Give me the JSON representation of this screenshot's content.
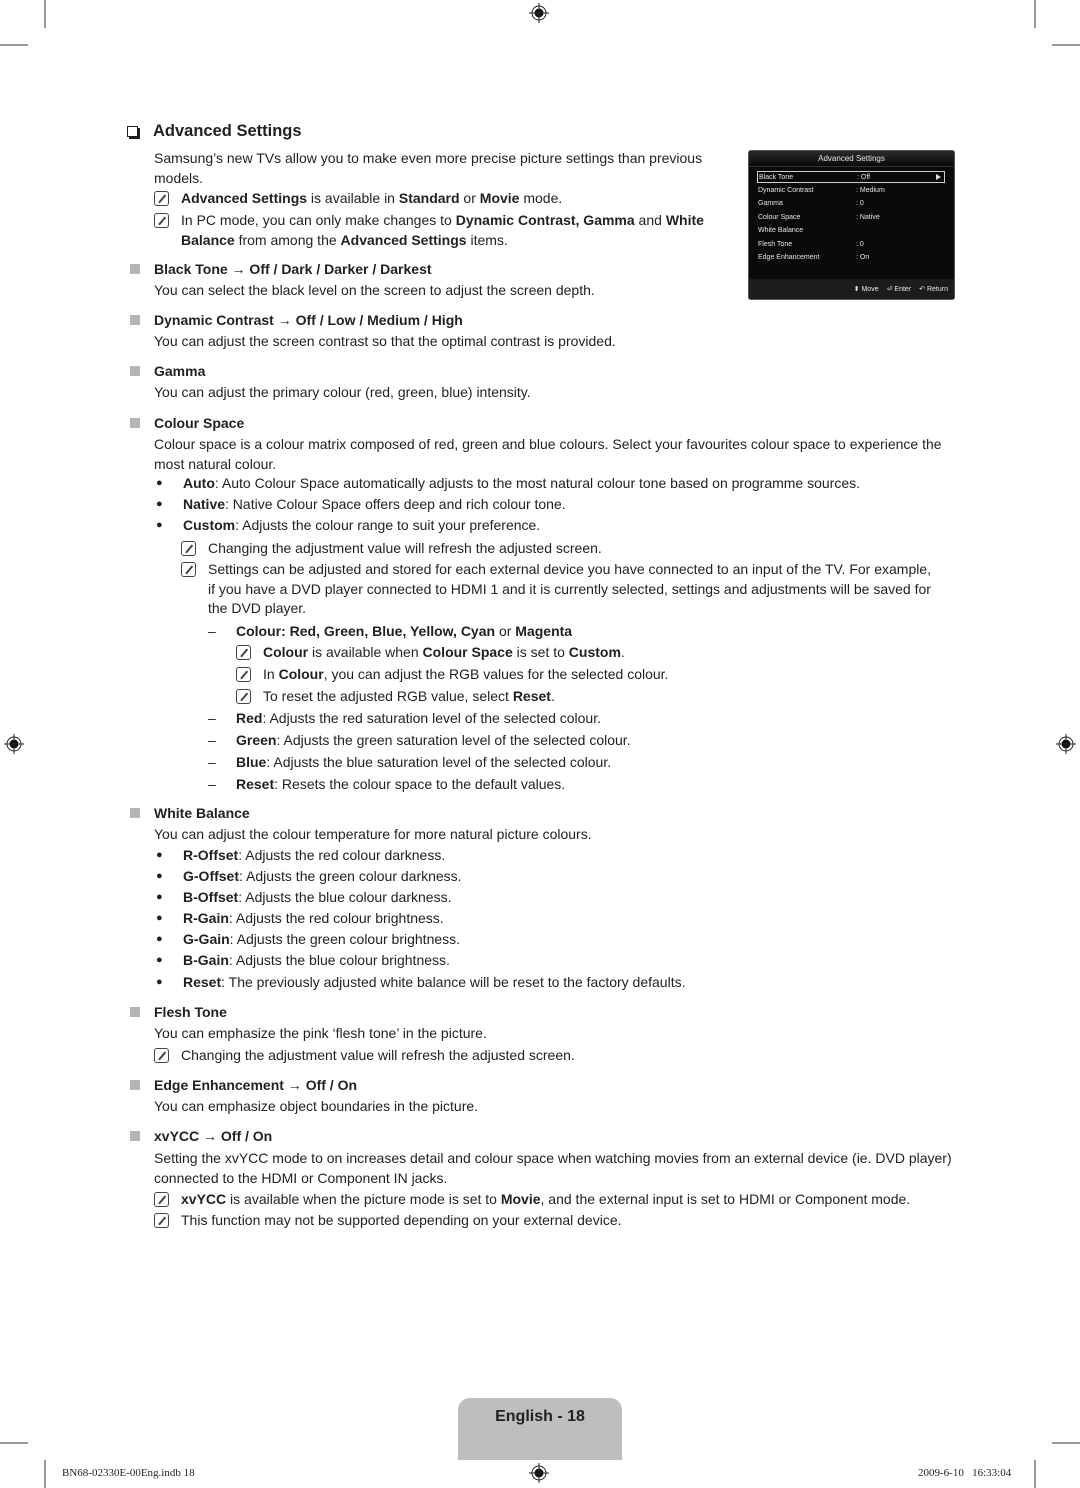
{
  "section": {
    "title": "Advanced Settings",
    "intro": "Samsung’s new TVs allow you to make even more precise picture settings than previous models.",
    "notes": [
      {
        "b1": "Advanced Settings",
        "t1": " is available in ",
        "b2": "Standard",
        "t2": " or ",
        "b3": "Movie",
        "t3": " mode."
      },
      {
        "t1": "In PC mode, you can only make changes to ",
        "b1": "Dynamic Contrast, Gamma",
        "t2": " and ",
        "b2": "White Balance",
        "t3": " from among the ",
        "b3": "Advanced Settings",
        "t4": " items."
      }
    ]
  },
  "items": {
    "black_tone": {
      "heading": "Black Tone → Off / Dark / Darker / Darkest",
      "desc": "You can select the black level on the screen to adjust the screen depth."
    },
    "dynamic_contrast": {
      "heading": "Dynamic Contrast → Off / Low / Medium / High",
      "desc": "You can adjust the screen contrast so that the optimal contrast is provided."
    },
    "gamma": {
      "heading": "Gamma",
      "desc": "You can adjust the primary colour (red, green, blue) intensity."
    },
    "colour_space": {
      "heading": "Colour Space",
      "desc": "Colour space is a colour matrix composed of red, green and blue colours. Select your favourites colour space to experience the most natural colour.",
      "options": [
        {
          "name": "Auto",
          "desc": ": Auto Colour Space automatically adjusts to the most natural colour tone based on programme sources."
        },
        {
          "name": "Native",
          "desc": ": Native Colour Space offers deep and rich colour tone."
        },
        {
          "name": "Custom",
          "desc": ": Adjusts the colour range to suit your preference."
        }
      ],
      "notes": [
        "Changing the adjustment value will refresh the adjusted screen.",
        "Settings can be adjusted and stored for each external device you have connected to an input of the TV. For example, if you have a DVD player connected to HDMI 1 and it is currently selected, settings and adjustments will be saved for the DVD player."
      ],
      "colour_heading": {
        "b1": "Colour: Red, Green, Blue, Yellow, Cyan",
        "t1": " or ",
        "b2": "Magenta"
      },
      "colour_notes": [
        {
          "b1": "Colour",
          "t1": " is available when ",
          "b2": "Colour Space",
          "t2": " is set to ",
          "b3": "Custom",
          "t3": "."
        },
        {
          "t1": "In ",
          "b1": "Colour",
          "t2": ", you can adjust the RGB values for the selected colour."
        },
        {
          "t1": "To reset the adjusted RGB value, select ",
          "b1": "Reset",
          "t2": "."
        }
      ],
      "sub_options": [
        {
          "name": "Red",
          "desc": ": Adjusts the red saturation level of the selected colour."
        },
        {
          "name": "Green",
          "desc": ": Adjusts the green saturation level of the selected colour."
        },
        {
          "name": "Blue",
          "desc": ": Adjusts the blue saturation level of the selected colour."
        },
        {
          "name": "Reset",
          "desc": ": Resets the colour space to the default values."
        }
      ]
    },
    "white_balance": {
      "heading": "White Balance",
      "desc": "You can adjust the colour temperature for more natural picture colours.",
      "options": [
        {
          "name": "R-Offset",
          "desc": ": Adjusts the red colour darkness."
        },
        {
          "name": "G-Offset",
          "desc": ": Adjusts the green colour darkness."
        },
        {
          "name": "B-Offset",
          "desc": ": Adjusts the blue colour darkness."
        },
        {
          "name": "R-Gain",
          "desc": ": Adjusts the red colour brightness."
        },
        {
          "name": "G-Gain",
          "desc": ": Adjusts the green colour brightness."
        },
        {
          "name": "B-Gain",
          "desc": ": Adjusts the blue colour brightness."
        },
        {
          "name": "Reset",
          "desc": ": The previously adjusted white balance will be reset to the factory defaults."
        }
      ]
    },
    "flesh_tone": {
      "heading": "Flesh Tone",
      "desc": "You can emphasize the pink ‘flesh tone’ in the picture.",
      "note": "Changing the adjustment value will refresh the adjusted screen."
    },
    "edge_enhancement": {
      "heading": "Edge Enhancement → Off / On",
      "desc": "You can emphasize object boundaries in the picture."
    },
    "xvycc": {
      "heading": "xvYCC → Off / On",
      "desc": "Setting the xvYCC mode to on increases detail and colour space when watching movies from an external device (ie. DVD player) connected to the HDMI or Component IN jacks.",
      "notes": [
        {
          "b1": "xvYCC",
          "t1": " is available when the picture mode is set to ",
          "b2": "Movie",
          "t2": ", and the external input is set to HDMI or Component mode."
        },
        {
          "t1": "This function may not be supported depending on your external device."
        }
      ]
    }
  },
  "tv_menu": {
    "title": "Advanced Settings",
    "rows": [
      {
        "label": "Black Tone",
        "value": ": Off",
        "selected": true
      },
      {
        "label": "Dynamic Contrast",
        "value": ": Medium"
      },
      {
        "label": "Gamma",
        "value": ": 0"
      },
      {
        "label": "Colour Space",
        "value": ": Native"
      },
      {
        "label": "White Balance",
        "value": ""
      },
      {
        "label": "Flesh Tone",
        "value": ": 0"
      },
      {
        "label": "Edge Enhancement",
        "value": ": On"
      }
    ],
    "footer": {
      "move": "Move",
      "enter": "Enter",
      "return": "Return"
    }
  },
  "footer": {
    "page_label": "English - 18",
    "file": "BN68-02330E-00Eng.indb   18",
    "timestamp": "2009-6-10   16:33:04"
  }
}
